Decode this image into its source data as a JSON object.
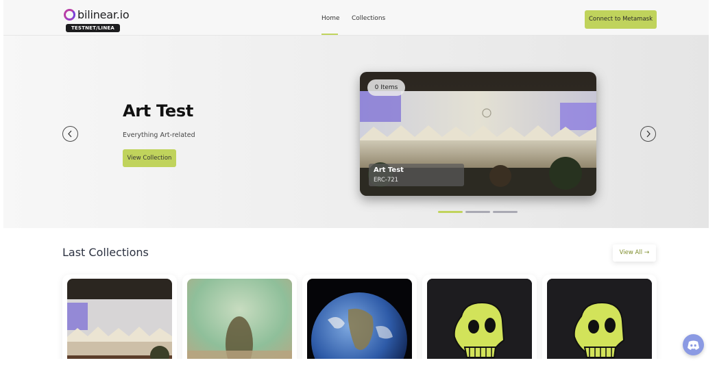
{
  "brand": {
    "name": "bilinear.io",
    "network_badge": "TESTNET/LINEA"
  },
  "nav": {
    "items": [
      {
        "label": "Home",
        "active": true
      },
      {
        "label": "Collections",
        "active": false
      }
    ]
  },
  "header": {
    "connect_label": "Connect to Metamask"
  },
  "hero": {
    "title": "Art Test",
    "subtitle": "Everything Art-related",
    "cta_label": "View Collection",
    "card": {
      "items_pill": "0 Items",
      "name": "Art Test",
      "standard": "ERC-721"
    },
    "slide_count": 3,
    "active_slide": 1
  },
  "last_collections": {
    "title": "Last Collections",
    "view_all_label": "View All",
    "view_all_icon": "arrow-right-icon",
    "cards": [
      {
        "image": "venice-festival-photo"
      },
      {
        "image": "blurry-tree-photo"
      },
      {
        "image": "earth-globe-photo"
      },
      {
        "image": "yellow-ape-skull"
      },
      {
        "image": "yellow-ape-skull"
      }
    ]
  },
  "colors": {
    "accent": "#c0d35c",
    "discord": "#8b9ae3",
    "dark": "#1c1c1e"
  },
  "icons": {
    "prev": "chevron-left-icon",
    "next": "chevron-right-icon",
    "chat": "discord-icon"
  }
}
